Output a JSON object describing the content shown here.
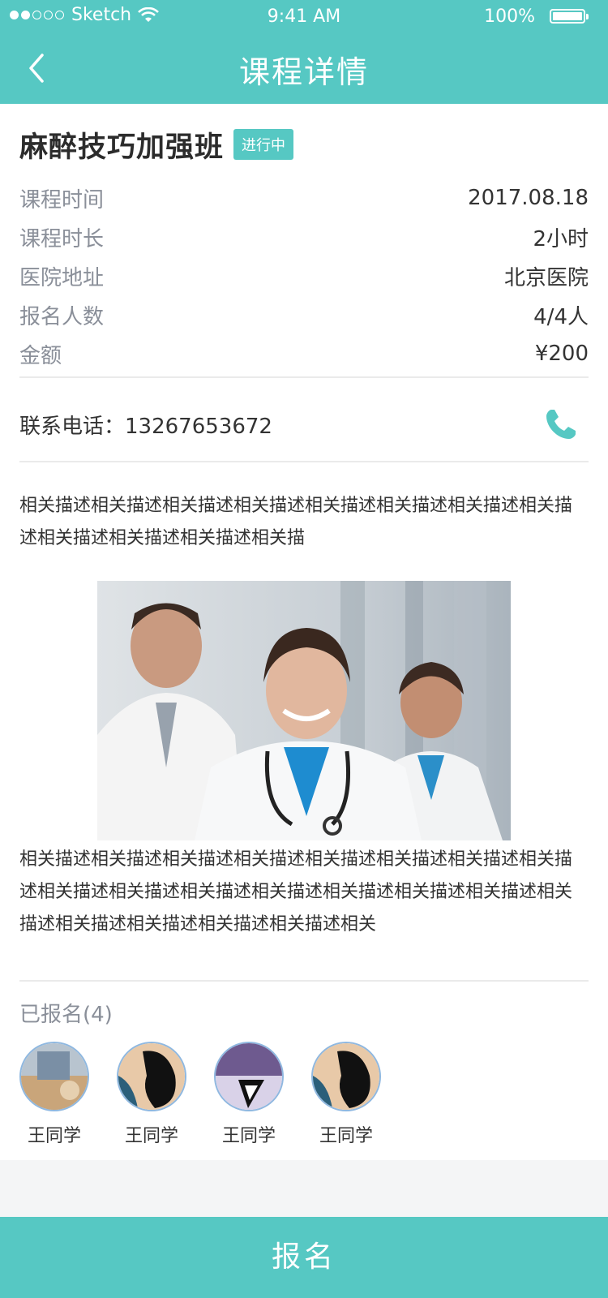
{
  "status_bar": {
    "carrier": "Sketch",
    "time": "9:41 AM",
    "battery": "100%"
  },
  "nav": {
    "title": "课程详情"
  },
  "course": {
    "name": "麻醉技巧加强班",
    "status_badge": "进行中",
    "info": [
      {
        "label": "课程时间",
        "value": "2017.08.18"
      },
      {
        "label": "课程时长",
        "value": "2小时"
      },
      {
        "label": "医院地址",
        "value": "北京医院"
      },
      {
        "label": "报名人数",
        "value": "4/4人"
      },
      {
        "label": "金额",
        "value": "¥200"
      }
    ],
    "contact_label": "联系电话：",
    "contact_phone": "13267653672",
    "description_1": "相关描述相关描述相关描述相关描述相关描述相关描述相关描述相关描述相关描述相关描述相关描述相关描",
    "description_2": "相关描述相关描述相关描述相关描述相关描述相关描述相关描述相关描述相关描述相关描述相关描述相关描述相关描述相关描述相关描述相关描述相关描述相关描述相关描述相关描述相关"
  },
  "enrolled": {
    "label": "已报名(4)",
    "students": [
      {
        "name": "王同学"
      },
      {
        "name": "王同学"
      },
      {
        "name": "王同学"
      },
      {
        "name": "王同学"
      }
    ]
  },
  "action": {
    "signup_label": "报名"
  },
  "colors": {
    "primary": "#56c8c3",
    "label_gray": "#8a8f99",
    "text": "#333333"
  }
}
